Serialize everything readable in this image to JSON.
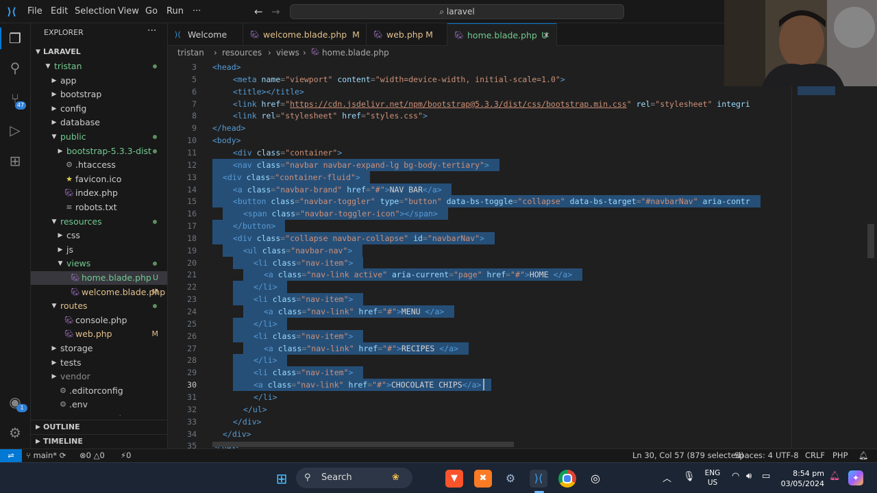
{
  "window": {
    "search": "laravel"
  },
  "menu": [
    "File",
    "Edit",
    "Selection",
    "View",
    "Go",
    "Run",
    "···"
  ],
  "activity": {
    "source_control_badge": "47",
    "accounts_badge": "1"
  },
  "explorer": {
    "title": "EXPLORER",
    "root": "LARAVEL",
    "items": [
      {
        "label": "tristan",
        "depth": 0,
        "type": "folder-open",
        "color": "#73c991",
        "dot": true
      },
      {
        "label": "app",
        "depth": 1,
        "type": "folder",
        "color": "#ccc"
      },
      {
        "label": "bootstrap",
        "depth": 1,
        "type": "folder",
        "color": "#ccc"
      },
      {
        "label": "config",
        "depth": 1,
        "type": "folder",
        "color": "#ccc"
      },
      {
        "label": "database",
        "depth": 1,
        "type": "folder",
        "color": "#ccc"
      },
      {
        "label": "public",
        "depth": 1,
        "type": "folder-open",
        "color": "#73c991",
        "dot": true
      },
      {
        "label": "bootstrap-5.3.3-dist",
        "depth": 2,
        "type": "folder",
        "color": "#73c991",
        "dot": true
      },
      {
        "label": ".htaccess",
        "depth": 2,
        "type": "file",
        "icon": "gear",
        "color": "#ccc"
      },
      {
        "label": "favicon.ico",
        "depth": 2,
        "type": "file",
        "icon": "star",
        "color": "#ccc"
      },
      {
        "label": "index.php",
        "depth": 2,
        "type": "file",
        "icon": "php",
        "color": "#ccc"
      },
      {
        "label": "robots.txt",
        "depth": 2,
        "type": "file",
        "icon": "lines",
        "color": "#ccc"
      },
      {
        "label": "resources",
        "depth": 1,
        "type": "folder-open",
        "color": "#73c991",
        "dot": true
      },
      {
        "label": "css",
        "depth": 2,
        "type": "folder",
        "color": "#ccc"
      },
      {
        "label": "js",
        "depth": 2,
        "type": "folder",
        "color": "#ccc"
      },
      {
        "label": "views",
        "depth": 2,
        "type": "folder-open",
        "color": "#73c991",
        "dot": true
      },
      {
        "label": "home.blade.php",
        "depth": 3,
        "type": "file",
        "icon": "php",
        "color": "#73c991",
        "status": "U",
        "selected": true
      },
      {
        "label": "welcome.blade.php",
        "depth": 3,
        "type": "file",
        "icon": "php",
        "color": "#e2c08d",
        "status": "M"
      },
      {
        "label": "routes",
        "depth": 1,
        "type": "folder-open",
        "color": "#e2c08d",
        "dot": true
      },
      {
        "label": "console.php",
        "depth": 2,
        "type": "file",
        "icon": "php",
        "color": "#ccc"
      },
      {
        "label": "web.php",
        "depth": 2,
        "type": "file",
        "icon": "php",
        "color": "#e2c08d",
        "status": "M"
      },
      {
        "label": "storage",
        "depth": 1,
        "type": "folder",
        "color": "#ccc"
      },
      {
        "label": "tests",
        "depth": 1,
        "type": "folder",
        "color": "#ccc"
      },
      {
        "label": "vendor",
        "depth": 1,
        "type": "folder",
        "color": "#8b8b8b"
      },
      {
        "label": ".editorconfig",
        "depth": 1,
        "type": "file",
        "icon": "gear",
        "color": "#ccc"
      },
      {
        "label": ".env",
        "depth": 1,
        "type": "file",
        "icon": "gear",
        "color": "#ccc"
      },
      {
        "label": ".env.example",
        "depth": 1,
        "type": "file",
        "icon": "gear",
        "color": "#ccc"
      }
    ],
    "outline": "OUTLINE",
    "timeline": "TIMELINE"
  },
  "tabs": [
    {
      "label": "Welcome",
      "status": ""
    },
    {
      "label": "welcome.blade.php",
      "status": "M"
    },
    {
      "label": "web.php",
      "status": "M"
    },
    {
      "label": "home.blade.php",
      "status": "U",
      "active": true
    }
  ],
  "breadcrumb": [
    "tristan",
    "resources",
    "views",
    "home.blade.php"
  ],
  "editor": {
    "lines": [
      {
        "n": "3",
        "indent": 0,
        "sel": false,
        "toks": [
          [
            "tg",
            "<head>"
          ]
        ]
      },
      {
        "n": "5",
        "indent": 2,
        "sel": false,
        "toks": [
          [
            "tg",
            "<meta "
          ],
          [
            "at",
            "name"
          ],
          [
            "pn",
            "="
          ],
          [
            "vl",
            "\"viewport\" "
          ],
          [
            "at",
            "content"
          ],
          [
            "pn",
            "="
          ],
          [
            "vl",
            "\"width=device-width, initial-scale=1.0\""
          ],
          [
            "tg",
            ">"
          ]
        ]
      },
      {
        "n": "6",
        "indent": 2,
        "sel": false,
        "toks": [
          [
            "tg",
            "<title></title>"
          ]
        ]
      },
      {
        "n": "7",
        "indent": 2,
        "sel": false,
        "toks": [
          [
            "tg",
            "<link "
          ],
          [
            "at",
            "href"
          ],
          [
            "pn",
            "="
          ],
          [
            "vl",
            "\""
          ],
          [
            "vl uline",
            "https://cdn.jsdelivr.net/npm/bootstrap@5.3.3/dist/css/bootstrap.min.css"
          ],
          [
            "vl",
            "\" "
          ],
          [
            "at",
            "rel"
          ],
          [
            "pn",
            "="
          ],
          [
            "vl",
            "\"stylesheet\" "
          ],
          [
            "at",
            "integri"
          ]
        ]
      },
      {
        "n": "8",
        "indent": 2,
        "sel": false,
        "toks": [
          [
            "tg",
            "<link "
          ],
          [
            "at",
            "rel"
          ],
          [
            "pn",
            "="
          ],
          [
            "vl",
            "\"stylesheet\" "
          ],
          [
            "at",
            "href"
          ],
          [
            "pn",
            "="
          ],
          [
            "vl",
            "\"styles.css\""
          ],
          [
            "tg",
            ">"
          ]
        ]
      },
      {
        "n": "9",
        "indent": 0,
        "sel": false,
        "toks": [
          [
            "tg",
            "</head>"
          ]
        ]
      },
      {
        "n": "10",
        "indent": 0,
        "sel": false,
        "toks": [
          [
            "tg",
            "<body>"
          ]
        ]
      },
      {
        "n": "11",
        "indent": 2,
        "sel": false,
        "toks": [
          [
            "tg",
            "<div "
          ],
          [
            "at",
            "class"
          ],
          [
            "pn",
            "="
          ],
          [
            "vl",
            "\"container\""
          ],
          [
            "tg",
            ">"
          ]
        ]
      },
      {
        "n": "12",
        "indent": 2,
        "sel": true,
        "toks": [
          [
            "tg",
            "<nav "
          ],
          [
            "at",
            "class"
          ],
          [
            "pn",
            "="
          ],
          [
            "vl",
            "\"navbar navbar-expand-lg bg-body-tertiary\""
          ],
          [
            "tg",
            ">"
          ]
        ]
      },
      {
        "n": "13",
        "indent": 1,
        "sel": true,
        "toks": [
          [
            "tg",
            "<div "
          ],
          [
            "at",
            "class"
          ],
          [
            "pn",
            "="
          ],
          [
            "vl",
            "\"container-fluid\""
          ],
          [
            "tg",
            ">"
          ]
        ]
      },
      {
        "n": "14",
        "indent": 2,
        "sel": true,
        "toks": [
          [
            "tg",
            "<a "
          ],
          [
            "at",
            "class"
          ],
          [
            "pn",
            "="
          ],
          [
            "vl",
            "\"navbar-brand\" "
          ],
          [
            "at",
            "href"
          ],
          [
            "pn",
            "="
          ],
          [
            "vl",
            "\"#\""
          ],
          [
            "tg",
            ">"
          ],
          [
            "tx",
            "NAV BAR"
          ],
          [
            "tg",
            "</a>"
          ]
        ]
      },
      {
        "n": "15",
        "indent": 2,
        "sel": true,
        "toks": [
          [
            "tg",
            "<button "
          ],
          [
            "at",
            "class"
          ],
          [
            "pn",
            "="
          ],
          [
            "vl",
            "\"navbar-toggler\" "
          ],
          [
            "at",
            "type"
          ],
          [
            "pn",
            "="
          ],
          [
            "vl",
            "\"button\" "
          ],
          [
            "at",
            "data-bs-toggle"
          ],
          [
            "pn",
            "="
          ],
          [
            "vl",
            "\"collapse\" "
          ],
          [
            "at",
            "data-bs-target"
          ],
          [
            "pn",
            "="
          ],
          [
            "vl",
            "\"#navbarNav\" "
          ],
          [
            "at",
            "aria-contr"
          ]
        ]
      },
      {
        "n": "16",
        "indent": 3,
        "sel": true,
        "toks": [
          [
            "tg",
            "<span "
          ],
          [
            "at",
            "class"
          ],
          [
            "pn",
            "="
          ],
          [
            "vl",
            "\"navbar-toggler-icon\""
          ],
          [
            "tg",
            "></span>"
          ]
        ]
      },
      {
        "n": "17",
        "indent": 2,
        "sel": true,
        "toks": [
          [
            "tg",
            "</button>"
          ]
        ]
      },
      {
        "n": "18",
        "indent": 2,
        "sel": true,
        "toks": [
          [
            "tg",
            "<div "
          ],
          [
            "at",
            "class"
          ],
          [
            "pn",
            "="
          ],
          [
            "vl",
            "\"collapse navbar-collapse\" "
          ],
          [
            "at",
            "id"
          ],
          [
            "pn",
            "="
          ],
          [
            "vl",
            "\"navbarNav\""
          ],
          [
            "tg",
            ">"
          ]
        ]
      },
      {
        "n": "19",
        "indent": 3,
        "sel": true,
        "toks": [
          [
            "tg",
            "<ul "
          ],
          [
            "at",
            "class"
          ],
          [
            "pn",
            "="
          ],
          [
            "vl",
            "\"navbar-nav\""
          ],
          [
            "tg",
            ">"
          ]
        ]
      },
      {
        "n": "20",
        "indent": 4,
        "sel": true,
        "toks": [
          [
            "tg",
            "<li "
          ],
          [
            "at",
            "class"
          ],
          [
            "pn",
            "="
          ],
          [
            "vl",
            "\"nav-item\""
          ],
          [
            "tg",
            ">"
          ]
        ]
      },
      {
        "n": "21",
        "indent": 5,
        "sel": true,
        "toks": [
          [
            "tg",
            "<a "
          ],
          [
            "at",
            "class"
          ],
          [
            "pn",
            "="
          ],
          [
            "vl",
            "\"nav-link active\" "
          ],
          [
            "at",
            "aria-current"
          ],
          [
            "pn",
            "="
          ],
          [
            "vl",
            "\"page\" "
          ],
          [
            "at",
            "href"
          ],
          [
            "pn",
            "="
          ],
          [
            "vl",
            "\"#\""
          ],
          [
            "tg",
            ">"
          ],
          [
            "tx",
            "HOME "
          ],
          [
            "tg",
            "</a>"
          ]
        ]
      },
      {
        "n": "22",
        "indent": 4,
        "sel": true,
        "toks": [
          [
            "tg",
            "</li>"
          ]
        ]
      },
      {
        "n": "23",
        "indent": 4,
        "sel": true,
        "toks": [
          [
            "tg",
            "<li "
          ],
          [
            "at",
            "class"
          ],
          [
            "pn",
            "="
          ],
          [
            "vl",
            "\"nav-item\""
          ],
          [
            "tg",
            ">"
          ]
        ]
      },
      {
        "n": "24",
        "indent": 5,
        "sel": true,
        "toks": [
          [
            "tg",
            "<a "
          ],
          [
            "at",
            "class"
          ],
          [
            "pn",
            "="
          ],
          [
            "vl",
            "\"nav-link\" "
          ],
          [
            "at",
            "href"
          ],
          [
            "pn",
            "="
          ],
          [
            "vl",
            "\"#\""
          ],
          [
            "tg",
            ">"
          ],
          [
            "tx",
            "MENU "
          ],
          [
            "tg",
            "</a>"
          ]
        ]
      },
      {
        "n": "25",
        "indent": 4,
        "sel": true,
        "toks": [
          [
            "tg",
            "</li>"
          ]
        ]
      },
      {
        "n": "26",
        "indent": 4,
        "sel": true,
        "toks": [
          [
            "tg",
            "<li "
          ],
          [
            "at",
            "class"
          ],
          [
            "pn",
            "="
          ],
          [
            "vl",
            "\"nav-item\""
          ],
          [
            "tg",
            ">"
          ]
        ]
      },
      {
        "n": "27",
        "indent": 5,
        "sel": true,
        "toks": [
          [
            "tg",
            "<a "
          ],
          [
            "at",
            "class"
          ],
          [
            "pn",
            "="
          ],
          [
            "vl",
            "\"nav-link\" "
          ],
          [
            "at",
            "href"
          ],
          [
            "pn",
            "="
          ],
          [
            "vl",
            "\"#\""
          ],
          [
            "tg",
            ">"
          ],
          [
            "tx",
            "RECIPES "
          ],
          [
            "tg",
            "</a>"
          ]
        ]
      },
      {
        "n": "28",
        "indent": 4,
        "sel": true,
        "toks": [
          [
            "tg",
            "</li>"
          ]
        ]
      },
      {
        "n": "29",
        "indent": 4,
        "sel": true,
        "toks": [
          [
            "tg",
            "<li "
          ],
          [
            "at",
            "class"
          ],
          [
            "pn",
            "="
          ],
          [
            "vl",
            "\"nav-item\""
          ],
          [
            "tg",
            ">"
          ]
        ]
      },
      {
        "n": "30",
        "indent": 4,
        "sel": true,
        "toks": [
          [
            "tg",
            "<a "
          ],
          [
            "at",
            "class"
          ],
          [
            "pn",
            "="
          ],
          [
            "vl",
            "\"nav-link\" "
          ],
          [
            "at",
            "href"
          ],
          [
            "pn",
            "="
          ],
          [
            "vl",
            "\"#\""
          ],
          [
            "tg",
            ">"
          ],
          [
            "tx",
            "CHOCOLATE CHIPS"
          ],
          [
            "tg",
            "</a>"
          ]
        ],
        "current": true
      },
      {
        "n": "31",
        "indent": 4,
        "sel": false,
        "toks": [
          [
            "tg",
            "</li>"
          ]
        ]
      },
      {
        "n": "32",
        "indent": 3,
        "sel": false,
        "toks": [
          [
            "tg",
            "</ul>"
          ]
        ]
      },
      {
        "n": "33",
        "indent": 2,
        "sel": false,
        "toks": [
          [
            "tg",
            "</div>"
          ]
        ]
      },
      {
        "n": "34",
        "indent": 1,
        "sel": false,
        "toks": [
          [
            "tg",
            "</div>"
          ]
        ]
      },
      {
        "n": "35",
        "indent": 0,
        "sel": false,
        "toks": [
          [
            "tg",
            "</nav>"
          ]
        ]
      }
    ]
  },
  "status": {
    "branch": "main*",
    "errors": "0",
    "warnings": "0",
    "ports": "0",
    "position": "Ln 30, Col 57 (879 selected)",
    "spaces": "Spaces: 4",
    "encoding": "UTF-8",
    "eol": "CRLF",
    "language": "PHP"
  },
  "taskbar": {
    "search": "Search",
    "lang": "ENG",
    "region": "US",
    "time": "8:54 pm",
    "date": "03/05/2024"
  },
  "colors": {
    "accent": "#0078d4",
    "selection": "#264f78",
    "modified": "#e2c08d",
    "untracked": "#73c991"
  }
}
